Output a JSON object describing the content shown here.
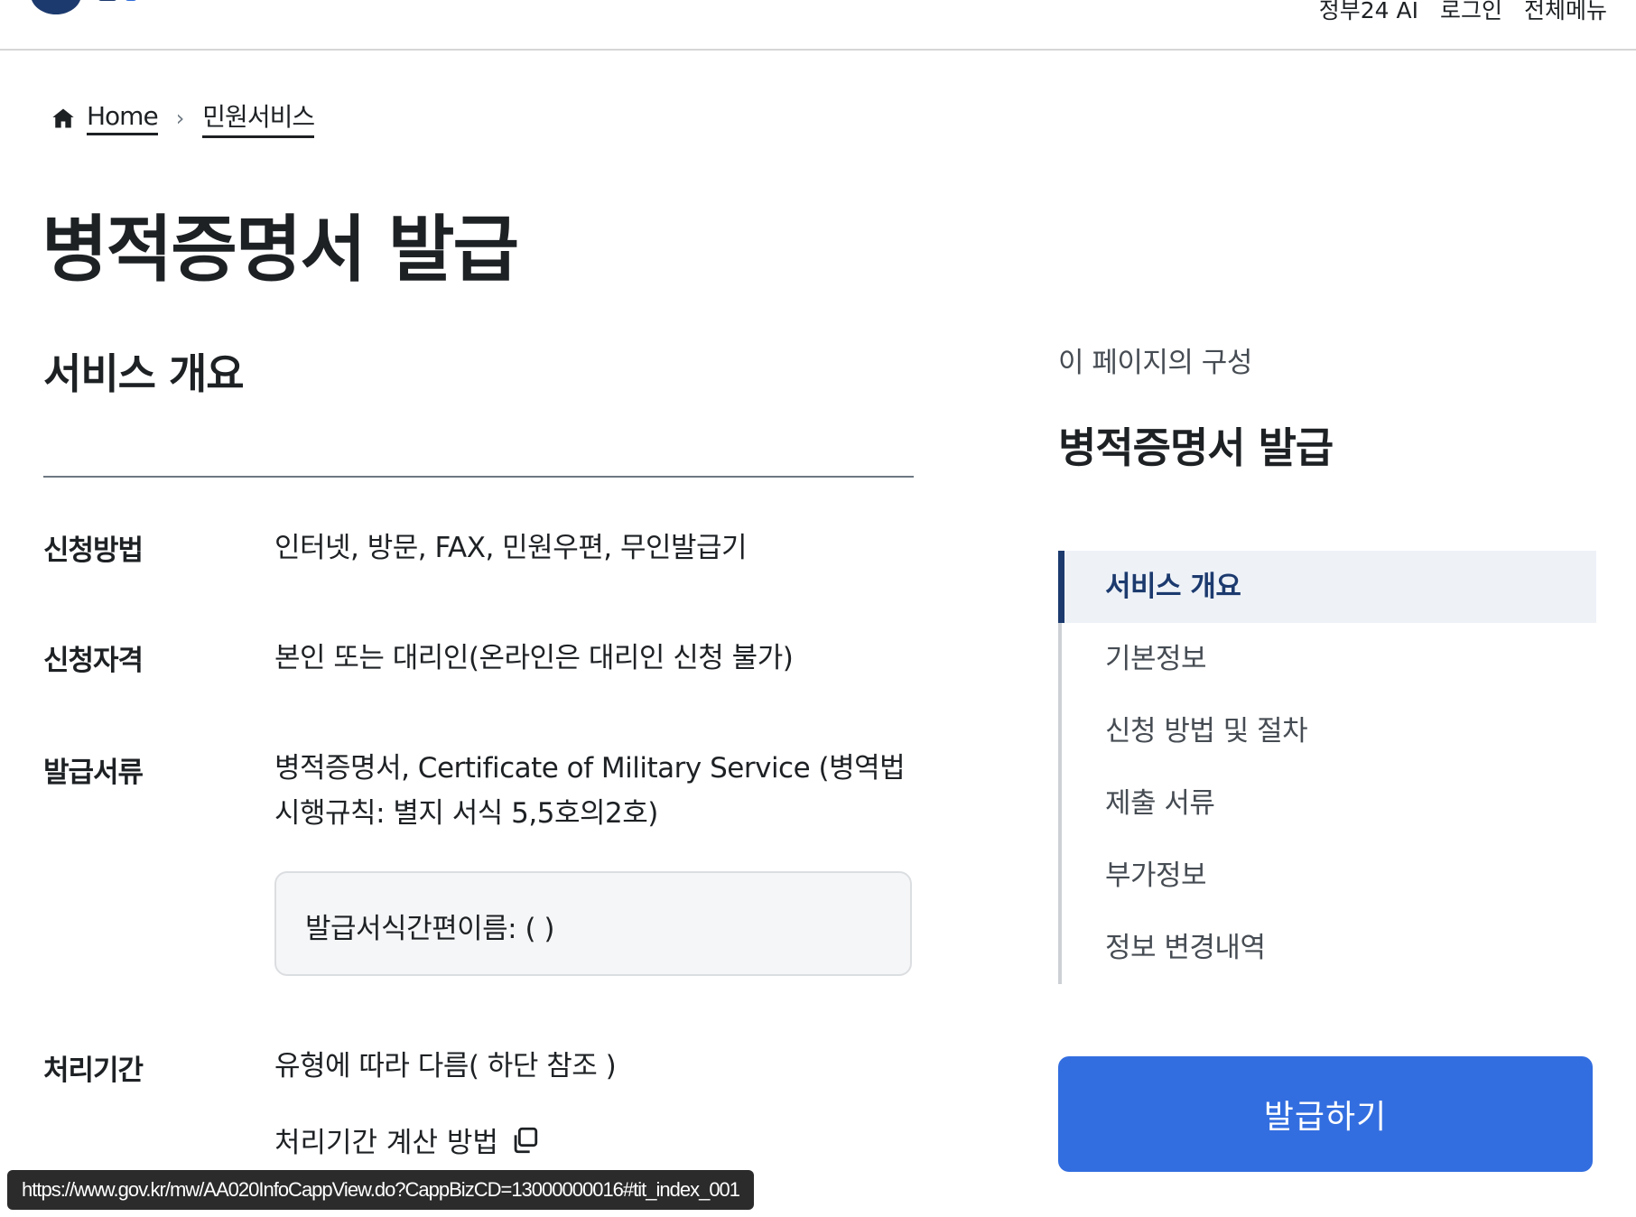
{
  "header": {
    "util_nav": [
      "정부24 AI",
      "로그인",
      "전체메뉴"
    ]
  },
  "breadcrumb": {
    "home": "Home",
    "current": "민원서비스"
  },
  "page_title": "병적증명서 발급",
  "overview": {
    "title": "서비스 개요",
    "rows": [
      {
        "label": "신청방법",
        "value": "인터넷, 방문, FAX, 민원우편, 무인발급기"
      },
      {
        "label": "신청자격",
        "value": "본인 또는 대리인(온라인은 대리인 신청 불가)"
      },
      {
        "label": "발급서류",
        "value": "병적증명서, Certificate of Military Service (병역법 시행규칙: 별지 서식 5,5호의2호)"
      },
      {
        "label": "처리기간",
        "value": "유형에 따라 다름( 하단 참조 )"
      }
    ],
    "note": "발급서식간편이름: ( )",
    "calc_link": "처리기간 계산 방법"
  },
  "sidebar": {
    "caption": "이 페이지의 구성",
    "heading": "병적증명서 발급",
    "toc": [
      "서비스 개요",
      "기본정보",
      "신청 방법 및 절차",
      "제출 서류",
      "부가정보",
      "정보 변경내역"
    ],
    "active_index": 0,
    "issue_button": "발급하기"
  },
  "status_url": "https://www.gov.kr/mw/AA020InfoCappView.do?CappBizCD=13000000016#tit_index_001",
  "colors": {
    "primary": "#336ee0",
    "navy": "#1c3a6e",
    "text": "#1e2124"
  }
}
